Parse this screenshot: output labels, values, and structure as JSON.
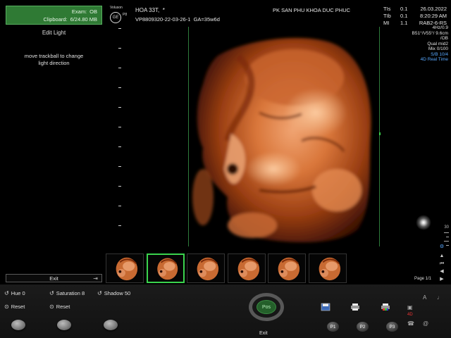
{
  "exam": {
    "label": "Exam:",
    "value": "OB"
  },
  "clipboard": {
    "label": "Clipboard:",
    "value": "6/24.80 MB"
  },
  "mode_title": "Edit Light",
  "hint": [
    "move trackball to change",
    "light direction"
  ],
  "exit_button": "Exit",
  "brand": {
    "name": "Voluson",
    "model": "P8",
    "logo": "GE"
  },
  "patient": {
    "name": "HOA 33T,",
    "marker": "*",
    "id": "VP8809320-22-03-26-1",
    "ga": "GA=35w6d"
  },
  "hospital": "PK SAN PHU KHOA DUC PHUC",
  "indices": [
    {
      "name": "TIs",
      "value": "0.1"
    },
    {
      "name": "TIb",
      "value": "0.1"
    },
    {
      "name": "MI",
      "value": "1.1"
    }
  ],
  "date": "26.03.2022",
  "time": "8:20:29 AM",
  "probe": "RAB2-6-RS",
  "params": [
    "4Hz/0.9",
    "B51°/V55°/ 9.6cm",
    "/OB",
    "Qual mid2",
    "Mix 0/100",
    "S/B 10/4",
    "4D Real Time"
  ],
  "scale_max": "30",
  "thumbnails": [
    {
      "label": "img 1",
      "selected": false
    },
    {
      "label": "img 2",
      "selected": true
    },
    {
      "label": "img 3",
      "selected": false
    },
    {
      "label": "img 4",
      "selected": false
    },
    {
      "label": "img 5",
      "selected": false
    },
    {
      "label": "img 6",
      "selected": false
    }
  ],
  "page": "Page 1/1",
  "controls": {
    "hue": "Hue 0",
    "saturation": "Saturation 8",
    "shadow": "Shadow 50",
    "reset1": "Reset",
    "reset2": "Reset"
  },
  "pos": {
    "center": "Pos",
    "exit": "Exit"
  },
  "p_buttons": [
    "P1",
    "P2",
    "P3"
  ],
  "icons": {
    "hue": "rotate-icon",
    "saturation": "rotate-icon",
    "shadow": "rotate-icon",
    "reset": "target-icon",
    "save": "save-icon",
    "print1": "printer-icon",
    "print2": "printer-color-icon",
    "exit": "exit-arrow-icon",
    "globe": "globe-icon"
  },
  "colors": {
    "accent_green": "#3bd44e",
    "exam_green": "#2f7a34",
    "blue": "#58a8ff",
    "skin": "#d9763a"
  }
}
